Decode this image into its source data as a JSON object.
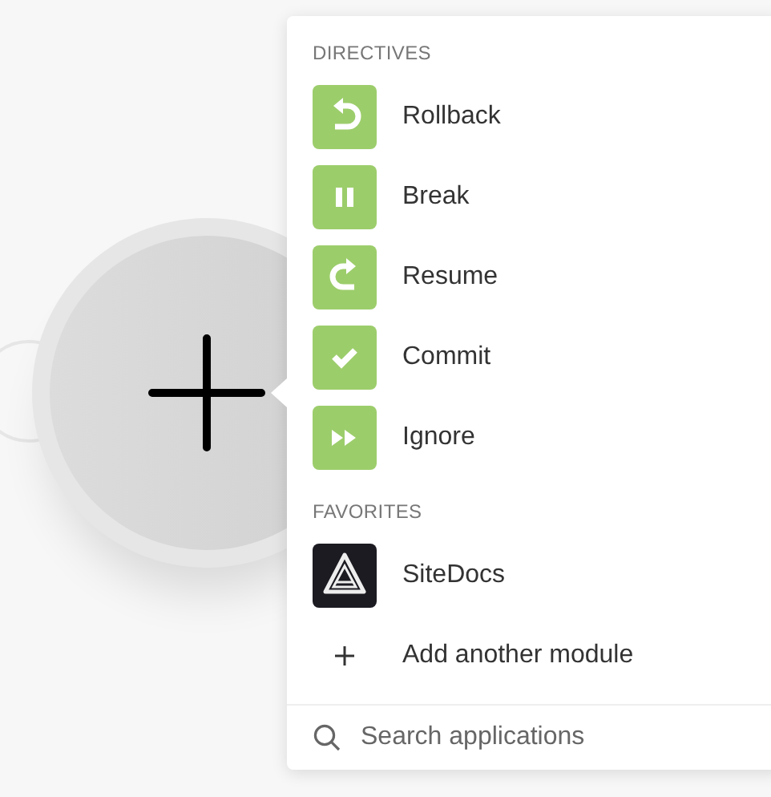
{
  "sections": [
    {
      "title": "DIRECTIVES",
      "items": [
        {
          "label": "Rollback",
          "kind": "rollback"
        },
        {
          "label": "Break",
          "kind": "pause"
        },
        {
          "label": "Resume",
          "kind": "resume"
        },
        {
          "label": "Commit",
          "kind": "check"
        },
        {
          "label": "Ignore",
          "kind": "forward"
        }
      ]
    },
    {
      "title": "FAVORITES",
      "items": [
        {
          "label": "SiteDocs",
          "kind": "app"
        }
      ]
    }
  ],
  "add_module": {
    "label": "Add another module"
  },
  "search": {
    "placeholder": "Search applications"
  }
}
